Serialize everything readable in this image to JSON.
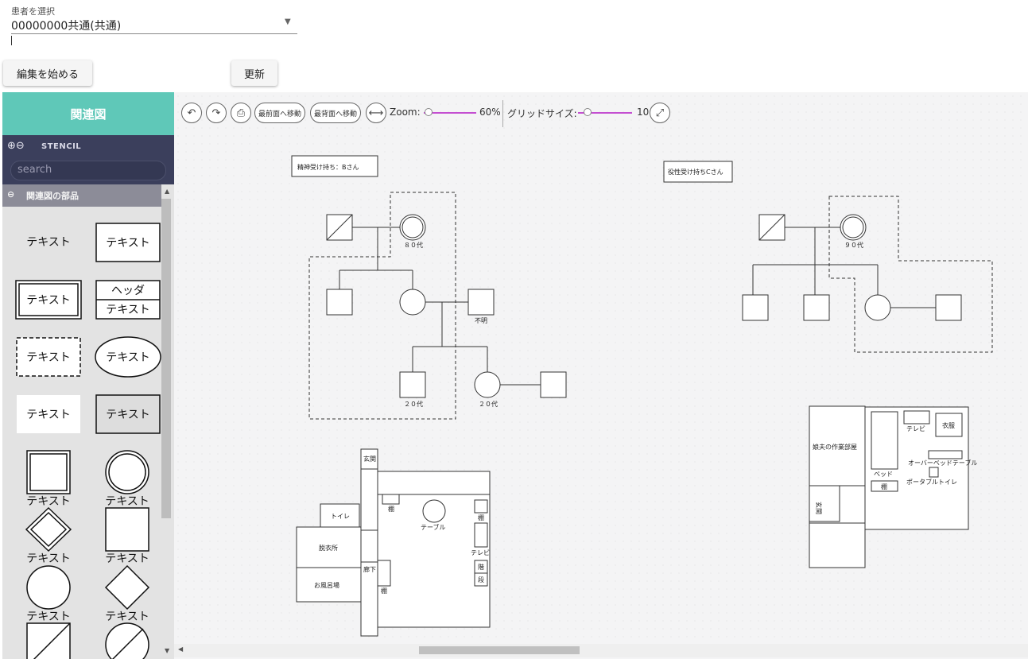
{
  "patient_select": {
    "label": "患者を選択",
    "value": "00000000共通(共通)"
  },
  "buttons": {
    "edit": "編集を始める",
    "update": "更新"
  },
  "sidebar": {
    "title": "関連図",
    "stencil_title": "STENCIL",
    "search_placeholder": "search",
    "group_title": "関連図の部品",
    "items": [
      "テキスト",
      "テキスト",
      "テキスト",
      "ヘッダ",
      "テキスト",
      "テキスト",
      "テキスト",
      "テキスト",
      "テキスト",
      "テキスト",
      "テキスト",
      "テキスト",
      "テキスト",
      "テキスト"
    ]
  },
  "toolbar": {
    "front_label": "最前面へ移動",
    "back_label": "最背面へ移動",
    "zoom_label": "Zoom:",
    "zoom_value": "60%",
    "grid_label": "グリッドサイズ:",
    "grid_value": "10",
    "icons": [
      "undo-icon",
      "redo-icon",
      "print-icon",
      "fit-width-icon",
      "fullscreen-icon"
    ]
  },
  "diagram": {
    "labels": {
      "box1": "精神受け持ち：Bさん",
      "box2": "役性受け持ちCさん",
      "age80": "８０代",
      "unknown": "不明",
      "age20a": "２０代",
      "age20b": "２０代",
      "age90": "９０代"
    },
    "floor1": {
      "entrance": "玄関",
      "toilet": "トイレ",
      "dressing": "脱衣所",
      "bath": "お風呂場",
      "hall": "廊下",
      "shelf1": "棚",
      "shelf2": "棚",
      "shelf3": "棚",
      "table": "テーブル",
      "tv": "テレビ",
      "stairs1": "階",
      "stairs2": "段"
    },
    "floor2": {
      "room": "娘夫の作業部屋",
      "entrance": "玄関",
      "bed": "ベッド",
      "shelf": "棚",
      "tv": "テレビ",
      "closet": "衣服",
      "overbed": "オーバーベッドテーブル",
      "toilet": "ポータブルトイレ"
    }
  }
}
